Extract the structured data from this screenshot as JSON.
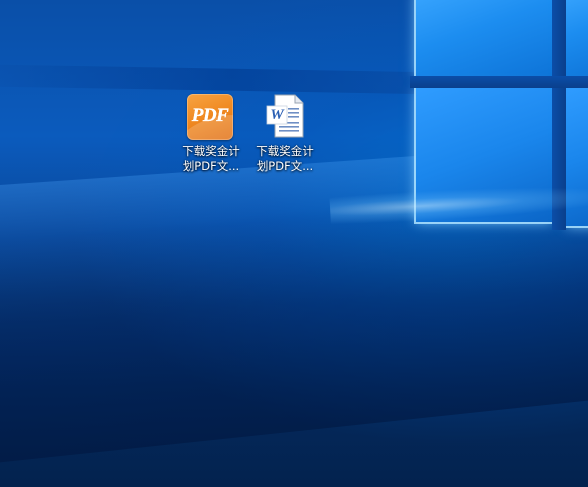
{
  "desktop": {
    "icons": [
      {
        "label_line1": "下载奖金计",
        "label_line2": "划PDF文...",
        "icon": "pdf-reader-icon",
        "badge_text": "PDF",
        "accent": "#f08a22"
      },
      {
        "label_line1": "下载奖金计",
        "label_line2": "划PDF文...",
        "icon": "word-document-icon",
        "badge_text": "W",
        "accent": "#2b5fb3"
      }
    ]
  },
  "colors": {
    "wallpaper_primary": "#0a4fa8",
    "wallpaper_dark": "#03224e",
    "window_light": "#3aa6ff"
  }
}
